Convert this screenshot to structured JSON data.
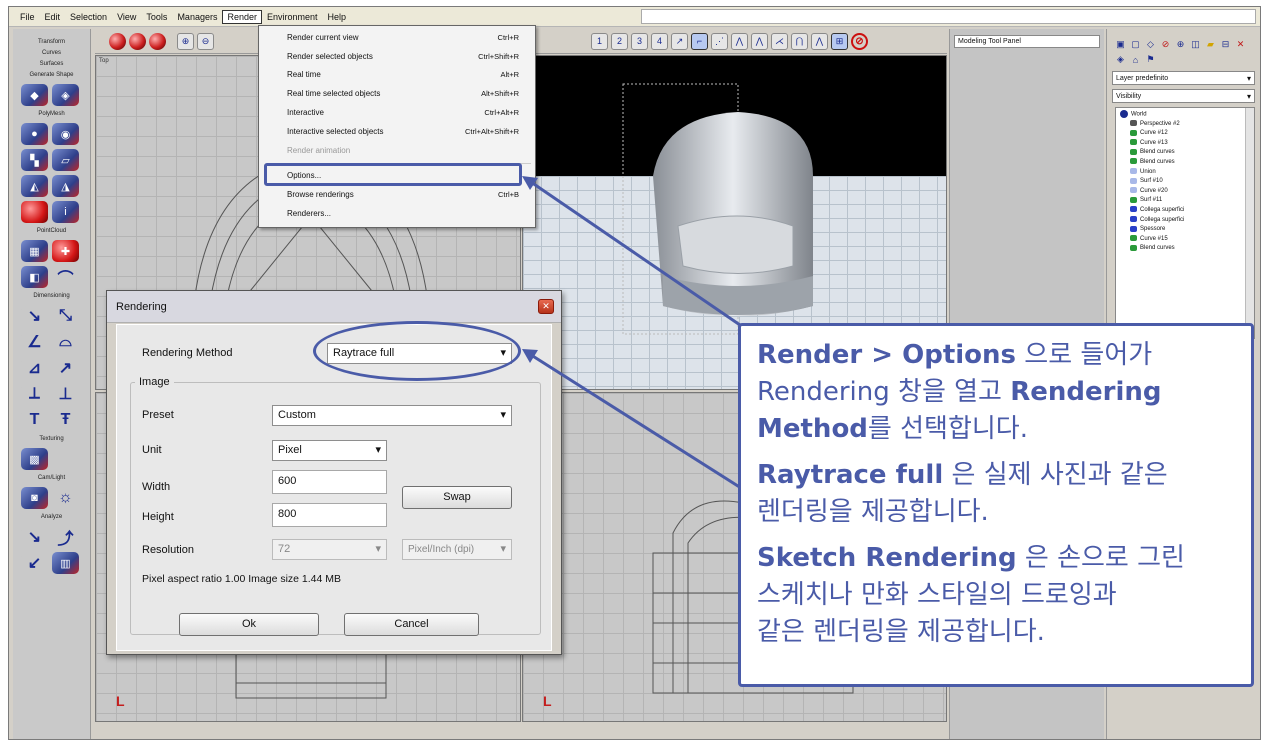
{
  "menubar": {
    "items": [
      "File",
      "Edit",
      "Selection",
      "View",
      "Tools",
      "Managers",
      "Render",
      "Environment",
      "Help"
    ],
    "active_index": 6
  },
  "left_toolbar": {
    "tabs": [
      "Transform",
      "Curves",
      "Surfaces",
      "Generate Shape",
      "PolyMesh",
      "PointCloud",
      "Dimensioning",
      "Texturing",
      "Cam/Light",
      "Analyze"
    ]
  },
  "viewports": {
    "top_label": "Top"
  },
  "top_toolbar": {
    "buttons": [
      "1",
      "2",
      "3",
      "4"
    ]
  },
  "render_menu": {
    "items": [
      {
        "label": "Render current view",
        "shortcut": "Ctrl+R",
        "disabled": false
      },
      {
        "label": "Render selected objects",
        "shortcut": "Ctrl+Shift+R",
        "disabled": false
      },
      {
        "label": "Real time",
        "shortcut": "Alt+R",
        "disabled": false
      },
      {
        "label": "Real time selected objects",
        "shortcut": "Alt+Shift+R",
        "disabled": false
      },
      {
        "label": "Interactive",
        "shortcut": "Ctrl+Alt+R",
        "disabled": false
      },
      {
        "label": "Interactive selected objects",
        "shortcut": "Ctrl+Alt+Shift+R",
        "disabled": false
      },
      {
        "label": "Render animation",
        "shortcut": "",
        "disabled": true
      }
    ],
    "items2": [
      {
        "label": "Options...",
        "shortcut": ""
      },
      {
        "label": "Browse renderings",
        "shortcut": "Ctrl+B"
      },
      {
        "label": "Renderers...",
        "shortcut": ""
      }
    ]
  },
  "tool_panel": {
    "title": "Modeling Tool Panel"
  },
  "right_panel": {
    "layer_combo": "Layer predefinito",
    "filter_combo": "Visibility",
    "tree": [
      "World",
      "Perspective #2",
      "Curve #12",
      "Curve #13",
      "Blend curves",
      "Blend curves",
      "Union",
      "Surf #10",
      "Curve #20",
      "Surf #11",
      "Collega superfici",
      "Collega superfici",
      "Spessore",
      "Curve #15",
      "Blend curves"
    ]
  },
  "dialog": {
    "title": "Rendering",
    "rendering_method_label": "Rendering Method",
    "rendering_method_value": "Raytrace full",
    "image_group": "Image",
    "preset_label": "Preset",
    "preset_value": "Custom",
    "unit_label": "Unit",
    "unit_value": "Pixel",
    "width_label": "Width",
    "width_value": "600",
    "height_label": "Height",
    "height_value": "800",
    "swap_label": "Swap",
    "resolution_label": "Resolution",
    "resolution_value": "72",
    "resolution_unit": "Pixel/Inch (dpi)",
    "info": "Pixel aspect ratio 1.00   Image size 1.44 MB",
    "ok_label": "Ok",
    "cancel_label": "Cancel"
  },
  "callout": {
    "l1_b1": "Render",
    "l1_sep": " > ",
    "l1_b2": "Options",
    "l1_rest": " 으로 들어가",
    "l2_pre": "Rendering 창을 열고 ",
    "l2_b": "Rendering",
    "l3_b": "Method",
    "l3_rest": "를 선택합니다.",
    "l4_b": "Raytrace full",
    "l4_rest": " 은 실제 사진과 같은",
    "l5": "렌더링을 제공합니다.",
    "l6_b": "Sketch Rendering",
    "l6_rest": " 은 손으로 그린",
    "l7": "스케치나 만화 스타일의 드로잉과",
    "l8": "같은 렌더링을 제공합니다."
  },
  "colors": {
    "accent": "#4a5ba8",
    "close_button": "#c0391b"
  }
}
